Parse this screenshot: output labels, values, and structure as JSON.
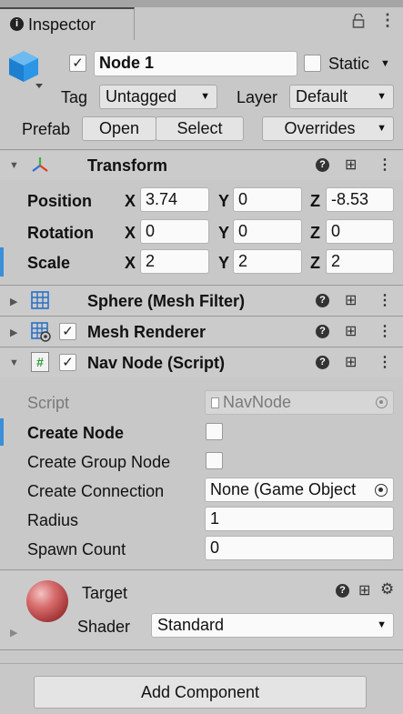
{
  "tab": {
    "title": "Inspector",
    "info_icon": "info-icon",
    "lock_icon": "lock-icon",
    "menu_icon": "kebab-menu-icon"
  },
  "gameobject": {
    "icon": "cube-icon",
    "active_checked": true,
    "name": "Node 1",
    "static_label": "Static",
    "static_checked": false,
    "tag_label": "Tag",
    "tag_value": "Untagged",
    "layer_label": "Layer",
    "layer_value": "Default",
    "prefab_label": "Prefab",
    "open_label": "Open",
    "select_label": "Select",
    "overrides_label": "Overrides"
  },
  "transform": {
    "title": "Transform",
    "position_label": "Position",
    "rotation_label": "Rotation",
    "scale_label": "Scale",
    "axis_x": "X",
    "axis_y": "Y",
    "axis_z": "Z",
    "position": {
      "x": "3.74",
      "y": "0",
      "z": "-8.53"
    },
    "rotation": {
      "x": "0",
      "y": "0",
      "z": "0"
    },
    "scale": {
      "x": "2",
      "y": "2",
      "z": "2"
    }
  },
  "mesh_filter": {
    "title": "Sphere (Mesh Filter)",
    "icon": "grid-icon"
  },
  "mesh_renderer": {
    "title": "Mesh Renderer",
    "icon": "mesh-renderer-icon",
    "enabled": true
  },
  "nav_node": {
    "title": "Nav Node (Script)",
    "icon": "script-icon",
    "enabled": true,
    "script_label": "Script",
    "script_value": "NavNode",
    "create_node_label": "Create Node",
    "create_group_node_label": "Create Group Node",
    "create_connection_label": "Create Connection",
    "create_connection_value": "None (Game Object",
    "radius_label": "Radius",
    "radius_value": "1",
    "spawn_count_label": "Spawn Count",
    "spawn_count_value": "0"
  },
  "material": {
    "name": "Target",
    "shader_label": "Shader",
    "shader_value": "Standard"
  },
  "footer": {
    "add_component_label": "Add Component"
  },
  "colors": {
    "accent": "#3a8fd9",
    "background": "#c8c8c8",
    "field": "#fafafa"
  }
}
